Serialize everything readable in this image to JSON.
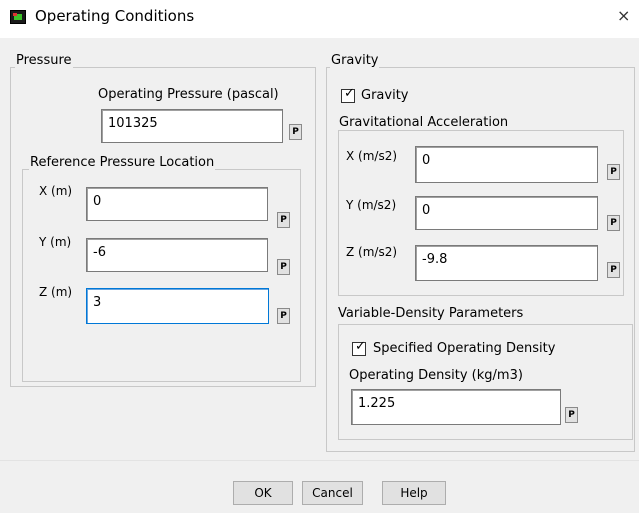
{
  "window": {
    "title": "Operating Conditions",
    "close_glyph": "×"
  },
  "pressure": {
    "group_label": "Pressure",
    "operating_pressure_label": "Operating Pressure (pascal)",
    "operating_pressure_value": "101325",
    "reference_location": {
      "group_label": "Reference Pressure Location",
      "x_label": "X (m)",
      "x_value": "0",
      "y_label": "Y (m)",
      "y_value": "-6",
      "z_label": "Z (m)",
      "z_value": "3"
    }
  },
  "gravity": {
    "group_label": "Gravity",
    "checkbox_label": "Gravity",
    "checked": true,
    "acceleration": {
      "group_label": "Gravitational Acceleration",
      "x_label": "X (m/s2)",
      "x_value": "0",
      "y_label": "Y (m/s2)",
      "y_value": "0",
      "z_label": "Z (m/s2)",
      "z_value": "-9.8"
    }
  },
  "variable_density": {
    "group_label": "Variable-Density Parameters",
    "checkbox_label": "Specified Operating Density",
    "checked": true,
    "density_label": "Operating Density (kg/m3)",
    "density_value": "1.225"
  },
  "param_button_label": "P",
  "check_glyph": "✓",
  "buttons": {
    "ok": "OK",
    "cancel": "Cancel",
    "help": "Help"
  }
}
